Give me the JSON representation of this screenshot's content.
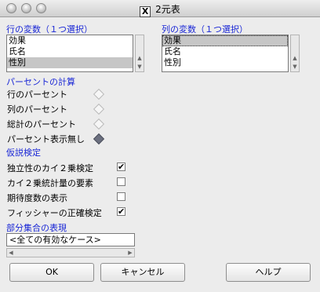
{
  "window": {
    "title": "2元表",
    "title_icon": "X"
  },
  "row_var": {
    "label": "行の変数（１つ選択）",
    "items": [
      "効果",
      "氏名",
      "性別"
    ],
    "selected_index": 2
  },
  "col_var": {
    "label": "列の変数（１つ選択）",
    "items": [
      "効果",
      "氏名",
      "性別"
    ],
    "selected_index": 0
  },
  "percent": {
    "label": "パーセントの計算",
    "options": [
      "行のパーセント",
      "列のパーセント",
      "総計のパーセント",
      "パーセント表示無し"
    ],
    "selected_index": 3
  },
  "tests": {
    "label": "仮説検定",
    "options": [
      {
        "label": "独立性のカイ２乗検定",
        "checked": true,
        "check_mark": "✔"
      },
      {
        "label": "カイ２乗統計量の要素",
        "checked": false,
        "check_mark": ""
      },
      {
        "label": "期待度数の表示",
        "checked": false,
        "check_mark": ""
      },
      {
        "label": "フィッシャーの正確検定",
        "checked": true,
        "check_mark": "✔"
      }
    ]
  },
  "subset": {
    "label": "部分集合の表現",
    "value": "<全ての有効なケース>"
  },
  "buttons": {
    "ok": "OK",
    "cancel": "キャンセル",
    "help": "ヘルプ"
  },
  "colors": {
    "section_label": "#1a27d6",
    "selection": "#c6c6c6"
  }
}
